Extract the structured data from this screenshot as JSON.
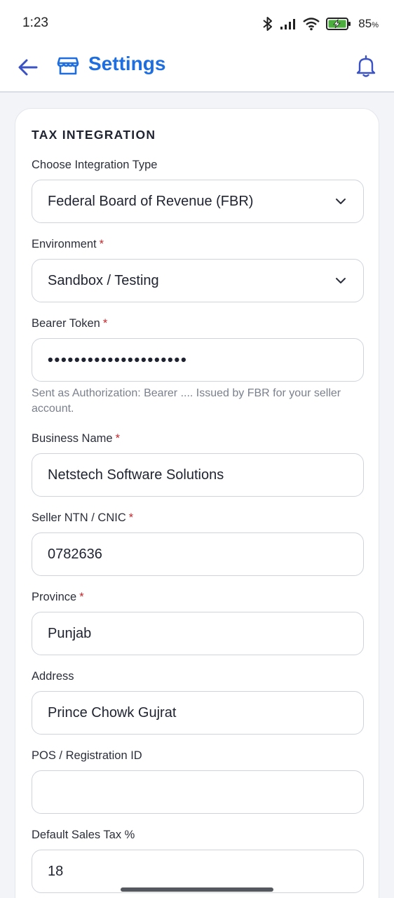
{
  "status_bar": {
    "time": "1:23",
    "battery_percent": "85",
    "battery_unit": "%"
  },
  "app_bar": {
    "title": "Settings",
    "accent_color": "#1e6ee0"
  },
  "form": {
    "section_title": "TAX INTEGRATION",
    "fields": {
      "integration_type": {
        "label": "Choose Integration Type",
        "value": "Federal Board of Revenue (FBR)"
      },
      "environment": {
        "label": "Environment",
        "required_mark": "*",
        "value": "Sandbox / Testing"
      },
      "bearer_token": {
        "label": "Bearer Token",
        "required_mark": "*",
        "value_masked": "•••••••••••••••••••••",
        "helper": "Sent as Authorization: Bearer .... Issued by FBR for your seller account."
      },
      "business_name": {
        "label": "Business Name",
        "required_mark": "*",
        "value": "Netstech Software Solutions"
      },
      "seller_ntn": {
        "label": "Seller NTN / CNIC",
        "required_mark": "*",
        "value": "0782636"
      },
      "province": {
        "label": "Province",
        "required_mark": "*",
        "value": "Punjab"
      },
      "address": {
        "label": "Address",
        "value": "Prince Chowk Gujrat"
      },
      "pos_id": {
        "label": "POS / Registration ID",
        "value": ""
      },
      "default_tax": {
        "label": "Default Sales Tax %",
        "value": "18"
      }
    }
  }
}
